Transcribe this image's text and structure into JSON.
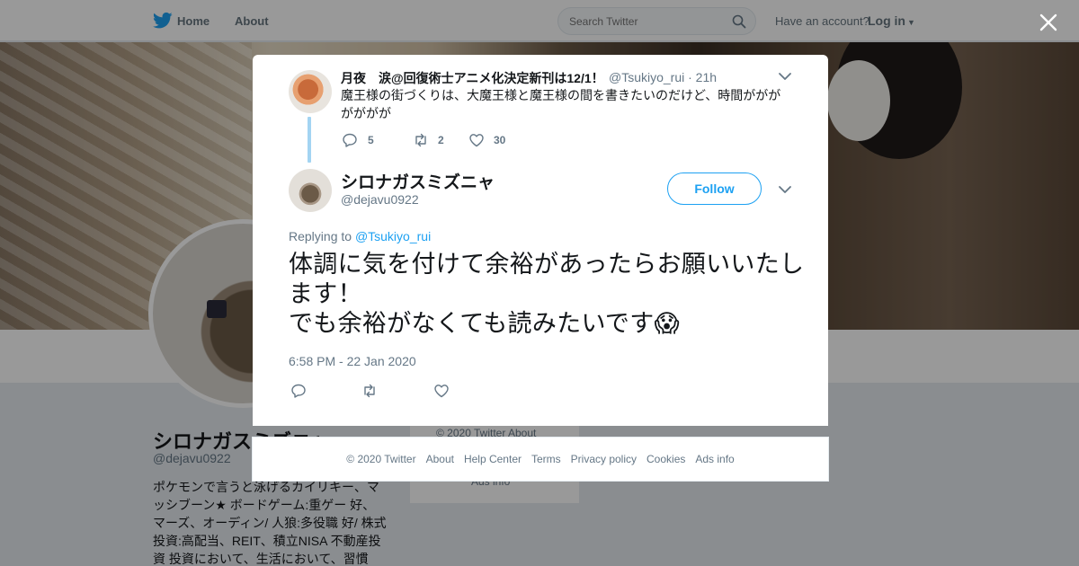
{
  "topbar": {
    "home_label": "Home",
    "about_label": "About",
    "search_placeholder": "Search Twitter",
    "have_account": "Have an account?",
    "login_label": "Log in"
  },
  "profile": {
    "name": "シロナガスミズニャ",
    "handle": "@dejavu0922",
    "bio": "ポケモンで言うと泳げるカイリキー、マッシブーン★ ボードゲーム:重ゲー 好、マーズ、オーディン/ 人狼:多役職 好/ 株式投資:高配当、REIT、積立NISA 不動産投資 投資において、生活において、習慣",
    "side_card_line1": "© 2020 Twitter   About",
    "side_card_line2": "Ads info"
  },
  "parent_tweet": {
    "name": "月夜　涙@回復術士アニメ化決定新刊は12/1！",
    "handle_time": "@Tsukiyo_rui · 21h",
    "text": "魔王様の街づくりは、大魔王様と魔王様の間を書きたいのだけど、時間ががががががが",
    "replies": "5",
    "retweets": "2",
    "likes": "30"
  },
  "reply_tweet": {
    "name": "シロナガスミズニャ",
    "handle": "@dejavu0922",
    "follow_label": "Follow",
    "replying_prefix": "Replying to",
    "replying_to": "@Tsukiyo_rui",
    "text_line1": "体調に気を付けて余裕があったらお願いいたします！",
    "text_line2": "でも余裕がなくても読みたいです",
    "emoji": "😱",
    "timestamp": "6:58 PM - 22 Jan 2020"
  },
  "footer": {
    "links": [
      "© 2020 Twitter",
      "About",
      "Help Center",
      "Terms",
      "Privacy policy",
      "Cookies",
      "Ads info"
    ]
  },
  "colors": {
    "accent": "#1da1f2",
    "muted": "#657786",
    "text": "#14171a",
    "thread_line": "#a3d4f2"
  }
}
